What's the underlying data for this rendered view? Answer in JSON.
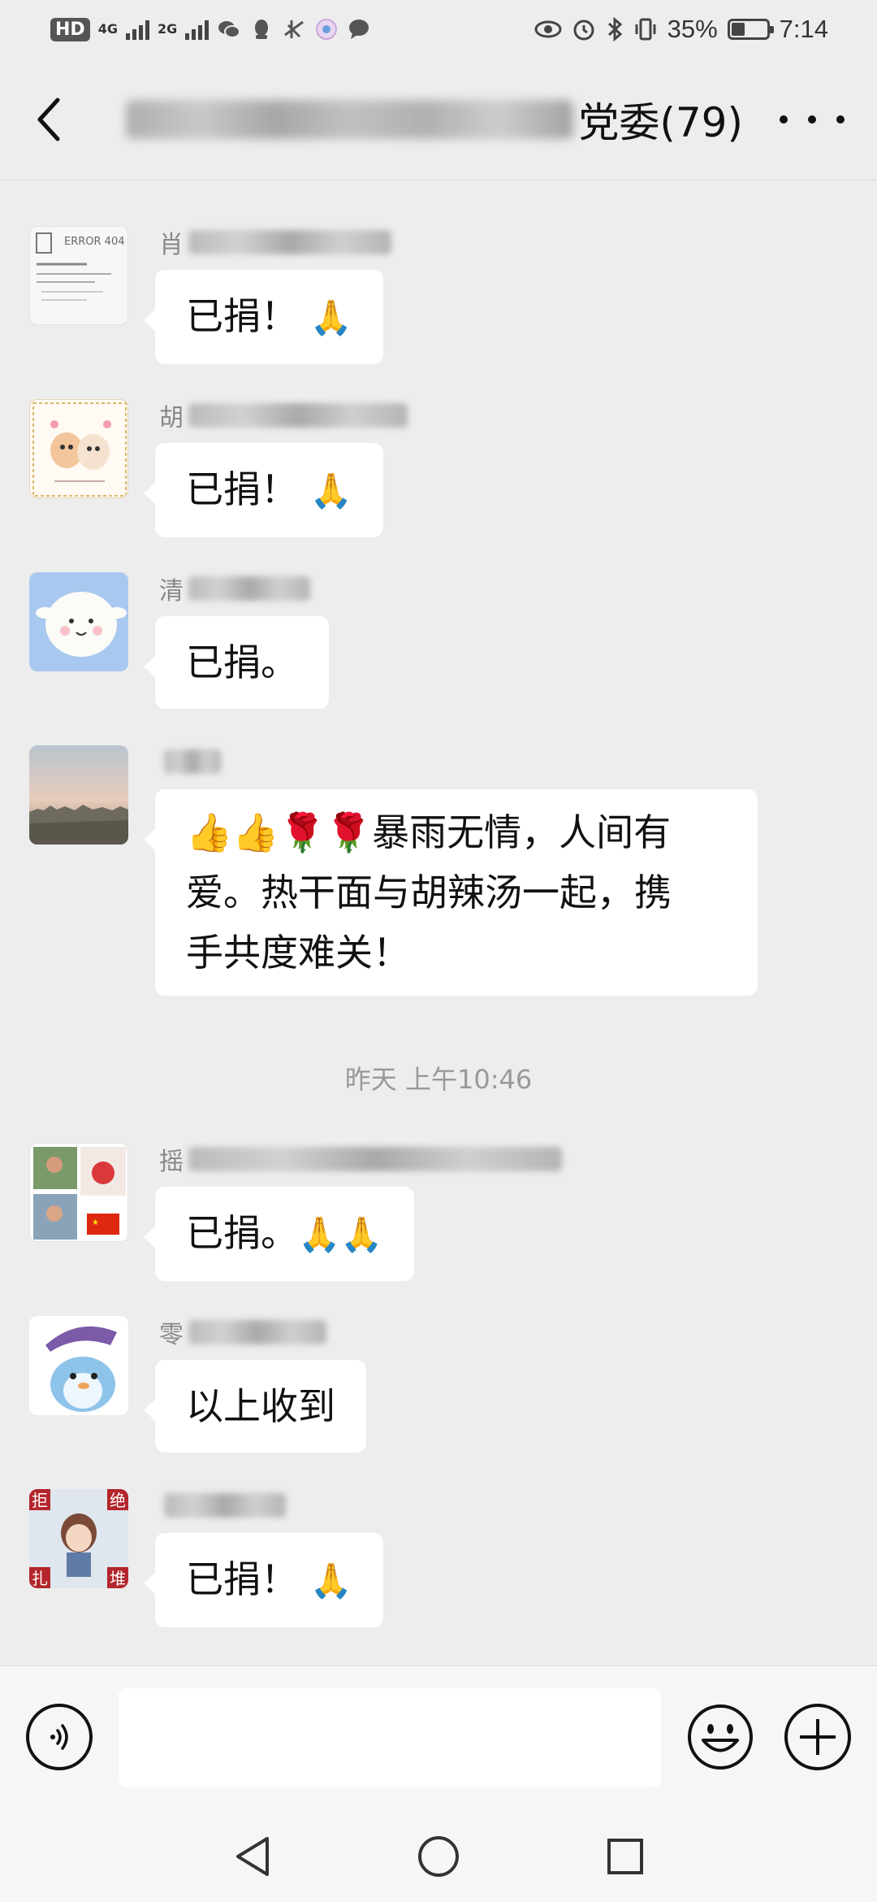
{
  "status_bar": {
    "hd_badge": "HD",
    "net1": "4G",
    "net2": "2G",
    "battery_percent": "35%",
    "battery_level": 0.35,
    "time": "7:14"
  },
  "header": {
    "title_visible": "党委(79)",
    "back_icon": "chevron-left-icon",
    "more_icon": "more-dots-icon"
  },
  "messages": [
    {
      "sender_first_char": "肖",
      "text": "已捐！",
      "emoji": "🙏",
      "avatar": "error-404-avatar"
    },
    {
      "sender_first_char": "胡",
      "text": "已捐！",
      "emoji": "🙏",
      "avatar": "cartoon-cats-avatar"
    },
    {
      "sender_first_char": "清",
      "text": "已捐。",
      "emoji": "",
      "avatar": "sheep-avatar"
    },
    {
      "sender_first_char": "",
      "text": "👍👍🌹🌹暴雨无情，人间有爱。热干面与胡辣汤一起，携手共度难关！",
      "emoji": "",
      "avatar": "city-skyline-avatar"
    },
    {
      "sender_first_char": "摇",
      "text": "已捐。",
      "emoji": "🙏🙏",
      "avatar": "photo-collage-avatar"
    },
    {
      "sender_first_char": "零",
      "text": "以上收到",
      "emoji": "",
      "avatar": "cartoon-penguin-avatar"
    },
    {
      "sender_first_char": "",
      "text": "已捐！",
      "emoji": "🙏",
      "avatar": "cartoon-girl-avatar"
    }
  ],
  "long_message_lines": [
    "👍👍🌹🌹暴雨无情，人间有",
    "爱。热干面与胡辣汤一起，携",
    "手共度难关！"
  ],
  "timestamp": "昨天 上午10:46",
  "avatar_text": {
    "error_title": "ERROR 404",
    "girl_corner_1": "拒",
    "girl_corner_2": "绝",
    "girl_corner_3": "扎",
    "girl_corner_4": "堆"
  },
  "input": {
    "placeholder": ""
  },
  "colors": {
    "background": "#ededed",
    "bubble": "#ffffff",
    "timestamp": "#999999"
  }
}
